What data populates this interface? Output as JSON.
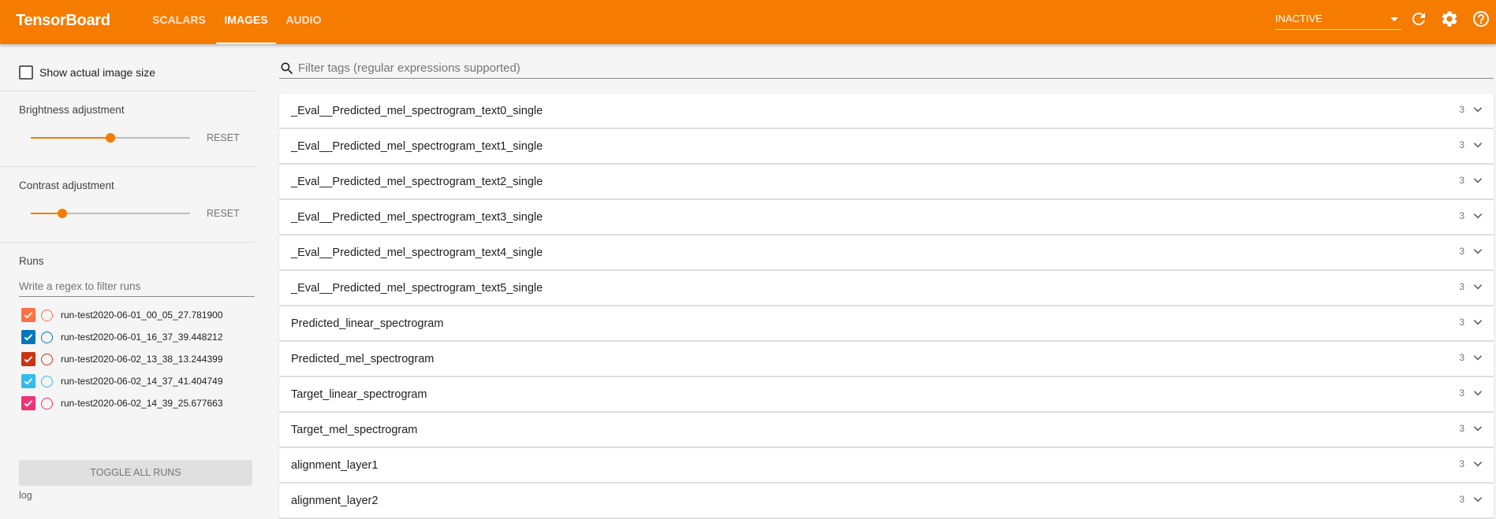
{
  "toolbar": {
    "brand": "TensorBoard",
    "tabs": [
      {
        "label": "SCALARS",
        "active": false
      },
      {
        "label": "IMAGES",
        "active": true
      },
      {
        "label": "AUDIO",
        "active": false
      }
    ],
    "status": "INACTIVE",
    "icons": [
      "refresh-icon",
      "settings-icon",
      "help-icon"
    ],
    "accent_color": "#f57c00"
  },
  "sidebar": {
    "show_actual_size": {
      "label": "Show actual image size",
      "checked": false
    },
    "brightness": {
      "label": "Brightness adjustment",
      "reset_label": "RESET",
      "level": 0.5
    },
    "contrast": {
      "label": "Contrast adjustment",
      "reset_label": "RESET",
      "level": 0.2
    },
    "runs": {
      "heading": "Runs",
      "filter_placeholder": "Write a regex to filter runs",
      "items": [
        {
          "name": "run-test2020-06-01_00_05_27.781900",
          "color": "#ff7043",
          "checked": true
        },
        {
          "name": "run-test2020-06-01_16_37_39.448212",
          "color": "#0077bb",
          "checked": true
        },
        {
          "name": "run-test2020-06-02_13_38_13.244399",
          "color": "#cc3311",
          "checked": true
        },
        {
          "name": "run-test2020-06-02_14_37_41.404749",
          "color": "#33bbee",
          "checked": true
        },
        {
          "name": "run-test2020-06-02_14_39_25.677663",
          "color": "#ee3377",
          "checked": true
        }
      ],
      "toggle_label": "TOGGLE ALL RUNS",
      "log_label": "log"
    }
  },
  "main": {
    "filter_placeholder": "Filter tags (regular expressions supported)",
    "tags": [
      {
        "name": "_Eval__Predicted_mel_spectrogram_text0_single",
        "count": "3"
      },
      {
        "name": "_Eval__Predicted_mel_spectrogram_text1_single",
        "count": "3"
      },
      {
        "name": "_Eval__Predicted_mel_spectrogram_text2_single",
        "count": "3"
      },
      {
        "name": "_Eval__Predicted_mel_spectrogram_text3_single",
        "count": "3"
      },
      {
        "name": "_Eval__Predicted_mel_spectrogram_text4_single",
        "count": "3"
      },
      {
        "name": "_Eval__Predicted_mel_spectrogram_text5_single",
        "count": "3"
      },
      {
        "name": "Predicted_linear_spectrogram",
        "count": "3"
      },
      {
        "name": "Predicted_mel_spectrogram",
        "count": "3"
      },
      {
        "name": "Target_linear_spectrogram",
        "count": "3"
      },
      {
        "name": "Target_mel_spectrogram",
        "count": "3"
      },
      {
        "name": "alignment_layer1",
        "count": "3"
      },
      {
        "name": "alignment_layer2",
        "count": "3"
      }
    ]
  }
}
